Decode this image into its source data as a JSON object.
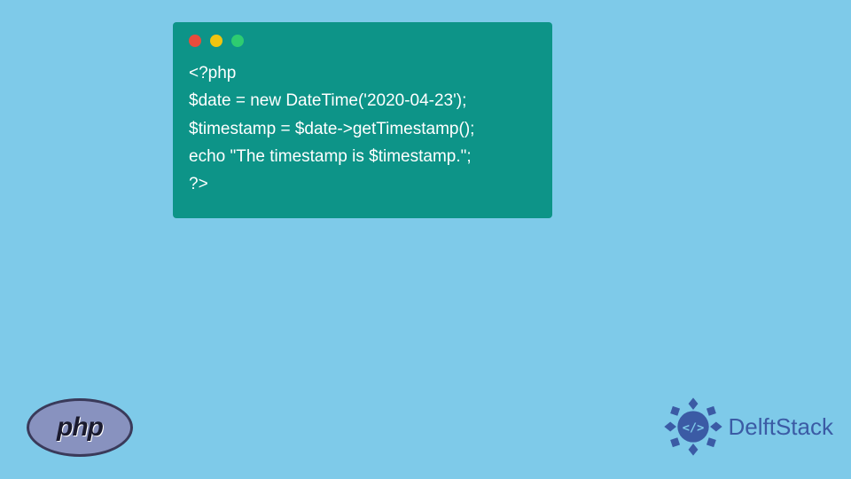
{
  "code": {
    "line1": "<?php",
    "line2": "$date = new DateTime('2020-04-23');",
    "line3": "$timestamp = $date->getTimestamp();",
    "line4": "echo \"The timestamp is $timestamp.\";",
    "line5": "?>"
  },
  "logos": {
    "php": "php",
    "delft": "DelftStack",
    "delft_badge": "</>"
  },
  "colors": {
    "background": "#7ecae9",
    "code_bg": "#0d9488",
    "code_fg": "#ffffff",
    "php_bg": "#8892bf",
    "delft_color": "#3b5ba5"
  }
}
